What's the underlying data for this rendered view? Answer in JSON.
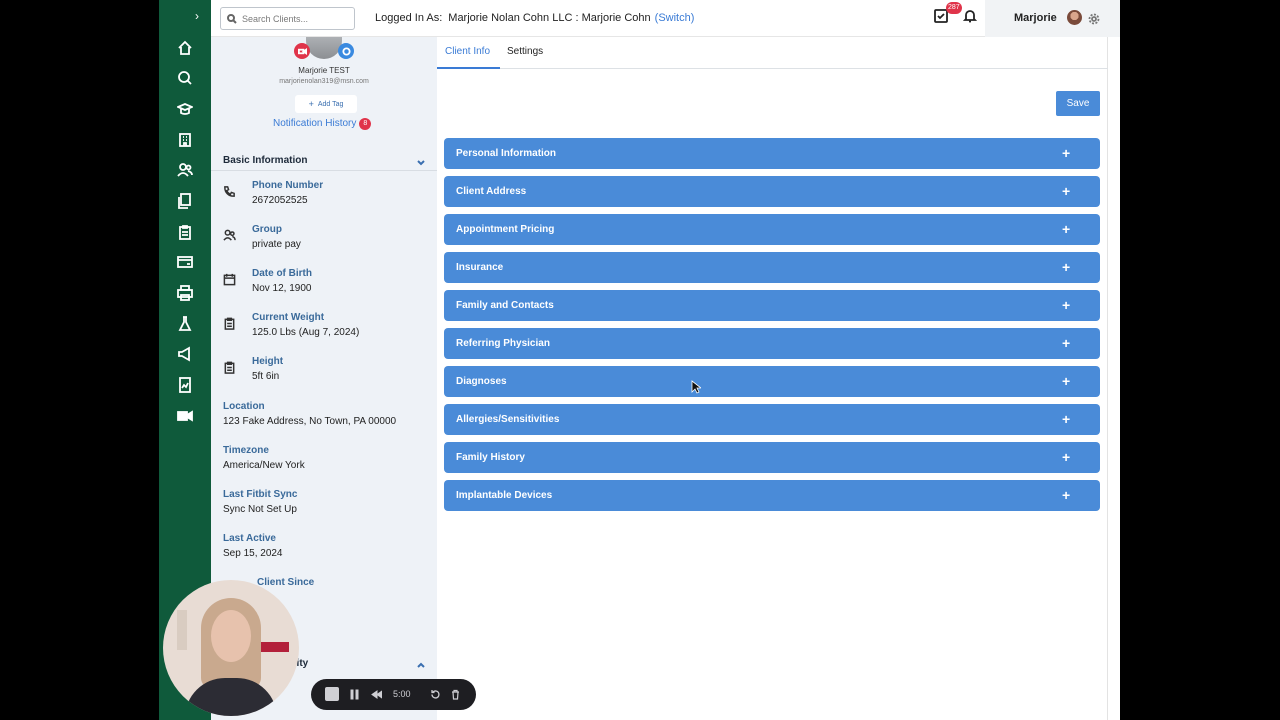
{
  "topbar": {
    "search_placeholder": "Search Clients...",
    "logged_in_label": "Logged In As:",
    "logged_in_user": "Marjorie Nolan Cohn LLC : Marjorie Cohn",
    "switch_label": "(Switch)",
    "tasks_badge": "287",
    "user_name": "Marjorie"
  },
  "profile": {
    "name": "Marjorie TEST",
    "email": "marjorienolan319@msn.com",
    "add_tag_label": "Add Tag",
    "notification_history_label": "Notification History",
    "notification_count": "8",
    "basic_info_title": "Basic Information",
    "fields": [
      {
        "label": "Phone Number",
        "value": "2672052525",
        "icon": "phone-icon"
      },
      {
        "label": "Group",
        "value": "private pay",
        "icon": "group-icon"
      },
      {
        "label": "Date of Birth",
        "value": "Nov 12, 1900",
        "icon": "calendar-icon"
      },
      {
        "label": "Current Weight",
        "value": "125.0 Lbs (Aug 7, 2024)",
        "icon": "clipboard-icon"
      },
      {
        "label": "Height",
        "value": "5ft 6in",
        "icon": "clipboard-icon"
      }
    ],
    "plain_fields": [
      {
        "label": "Location",
        "value": "123 Fake Address, No Town, PA 00000"
      },
      {
        "label": "Timezone",
        "value": "America/New York"
      },
      {
        "label": "Last Fitbit Sync",
        "value": "Sync Not Set Up"
      },
      {
        "label": "Last Active",
        "value": "Sep 15, 2024"
      },
      {
        "label": "Client Since",
        "value": ""
      }
    ],
    "access_section_partial": "ility"
  },
  "main": {
    "tabs": [
      {
        "label": "Client Info",
        "active": true
      },
      {
        "label": "Settings",
        "active": false
      }
    ],
    "save_label": "Save",
    "sections": [
      "Personal Information",
      "Client Address",
      "Appointment Pricing",
      "Insurance",
      "Family and Contacts",
      "Referring Physician",
      "Diagnoses",
      "Allergies/Sensitivities",
      "Family History",
      "Implantable Devices"
    ],
    "expand_glyph": "+"
  },
  "recorder": {
    "time": "5:00"
  },
  "colors": {
    "rail": "#0f5a3b",
    "accent": "#4a8bd8",
    "link": "#3a7bd5",
    "badge": "#e0344a",
    "panel": "#eef2f7"
  }
}
